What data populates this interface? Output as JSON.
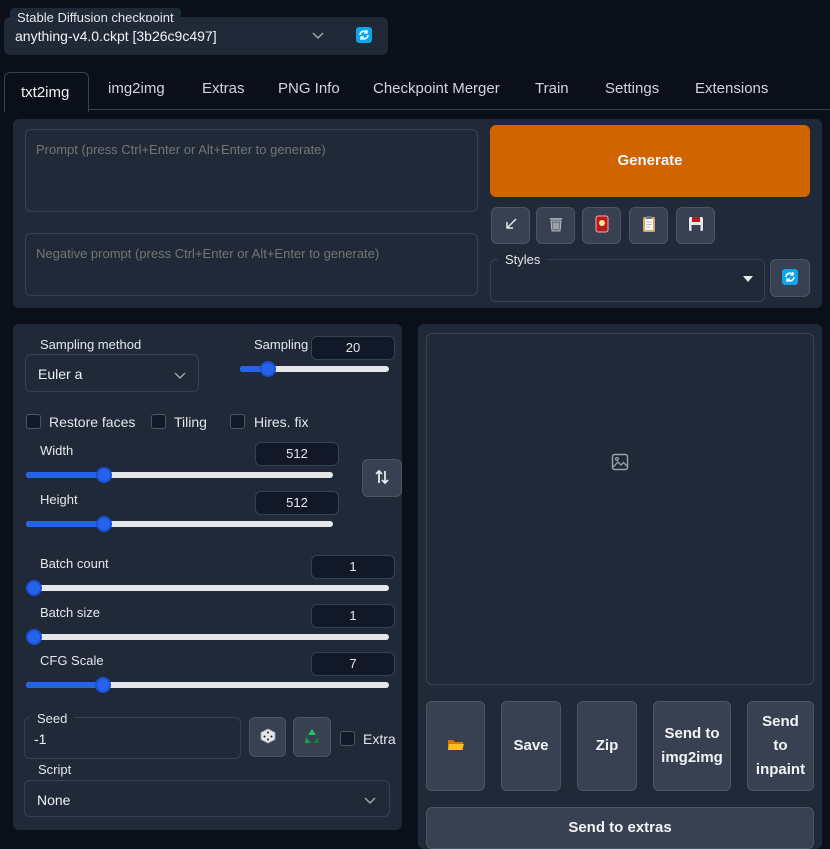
{
  "checkpoint": {
    "label": "Stable Diffusion checkpoint",
    "value": "anything-v4.0.ckpt [3b26c9c497]"
  },
  "tabs": [
    "txt2img",
    "img2img",
    "Extras",
    "PNG Info",
    "Checkpoint Merger",
    "Train",
    "Settings",
    "Extensions"
  ],
  "prompt": {
    "placeholder": "Prompt (press Ctrl+Enter or Alt+Enter to generate)",
    "negative_placeholder": "Negative prompt (press Ctrl+Enter or Alt+Enter to generate)"
  },
  "generate_label": "Generate",
  "styles_label": "Styles",
  "sampling": {
    "method_label": "Sampling method",
    "method_value": "Euler a",
    "steps_label": "Sampling",
    "steps_value": "20",
    "steps_fraction": 0.15
  },
  "checkboxes": {
    "restore_faces": "Restore faces",
    "tiling": "Tiling",
    "hires_fix": "Hires. fix"
  },
  "width": {
    "label": "Width",
    "value": "512",
    "fraction": 0.24
  },
  "height": {
    "label": "Height",
    "value": "512",
    "fraction": 0.24
  },
  "batch_count": {
    "label": "Batch count",
    "value": "1",
    "fraction": 0.0
  },
  "batch_size": {
    "label": "Batch size",
    "value": "1",
    "fraction": 0.0
  },
  "cfg_scale": {
    "label": "CFG Scale",
    "value": "7",
    "fraction": 0.2
  },
  "seed": {
    "label": "Seed",
    "value": "-1",
    "extra_label": "Extra"
  },
  "script": {
    "label": "Script",
    "value": "None"
  },
  "output_buttons": {
    "save": "Save",
    "zip": "Zip",
    "send_img2img": "Send to img2img",
    "send_inpaint": "Send to inpaint",
    "send_extras": "Send to extras"
  },
  "colors": {
    "accent": "#2563eb",
    "generate": "#d06500",
    "background": "#0b0f19",
    "panel": "#1f2937"
  }
}
